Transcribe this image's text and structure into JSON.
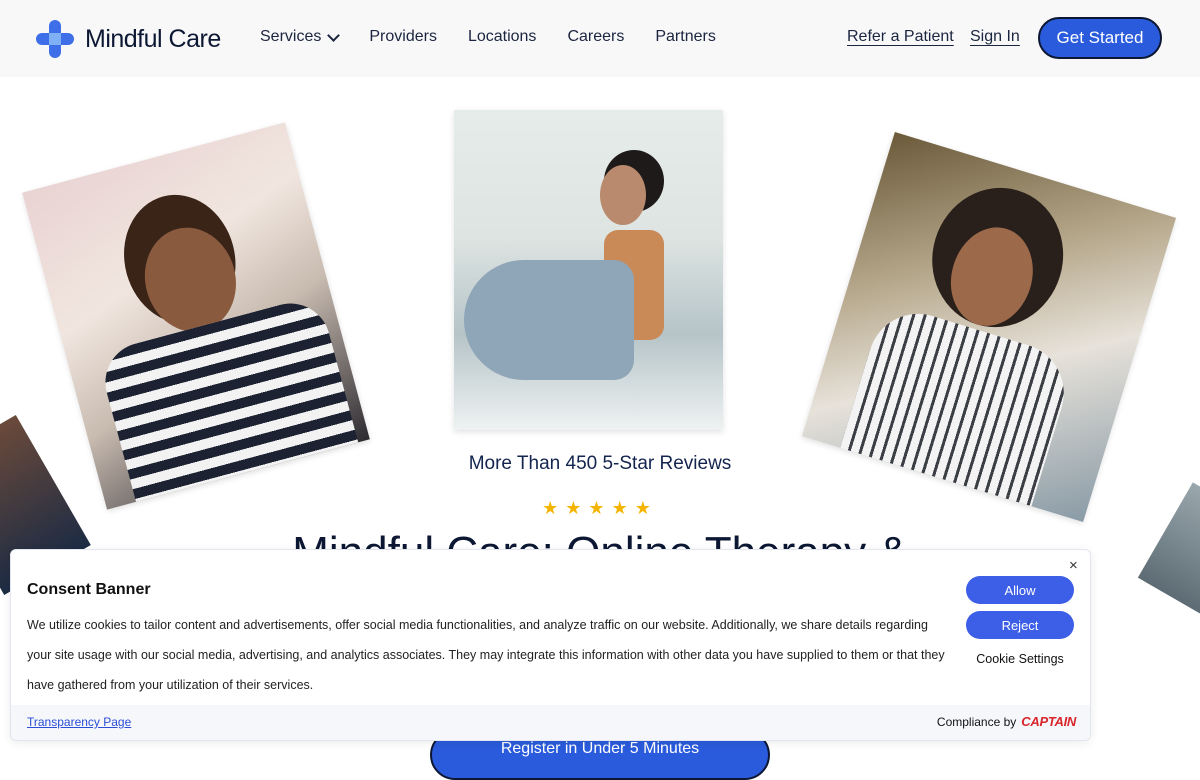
{
  "brand": {
    "name": "Mindful Care",
    "accent": "#2a5bdc"
  },
  "nav": {
    "items": [
      "Services",
      "Providers",
      "Locations",
      "Careers",
      "Partners"
    ],
    "refer_label": "Refer a Patient",
    "signin_label": "Sign In",
    "cta_label": "Get Started"
  },
  "hero": {
    "reviews_text": "More Than 450 5-Star Reviews",
    "stars": "★★★★★",
    "headline": "Mindful Care: Online Therapy &",
    "register_label": "Register in Under 5 Minutes"
  },
  "consent": {
    "title": "Consent Banner",
    "body": "We utilize cookies to tailor content and advertisements, offer social media functionalities, and analyze traffic on our website. Additionally, we share details regarding your site usage with our social media, advertising, and analytics associates. They may integrate this information with other data you have supplied to them or that they have gathered from your utilization of their services.",
    "allow_label": "Allow",
    "reject_label": "Reject",
    "settings_label": "Cookie Settings",
    "transparency_label": "Transparency Page",
    "compliance_label": "Compliance by",
    "compliance_brand": "CAPTAIN",
    "close_glyph": "×"
  }
}
